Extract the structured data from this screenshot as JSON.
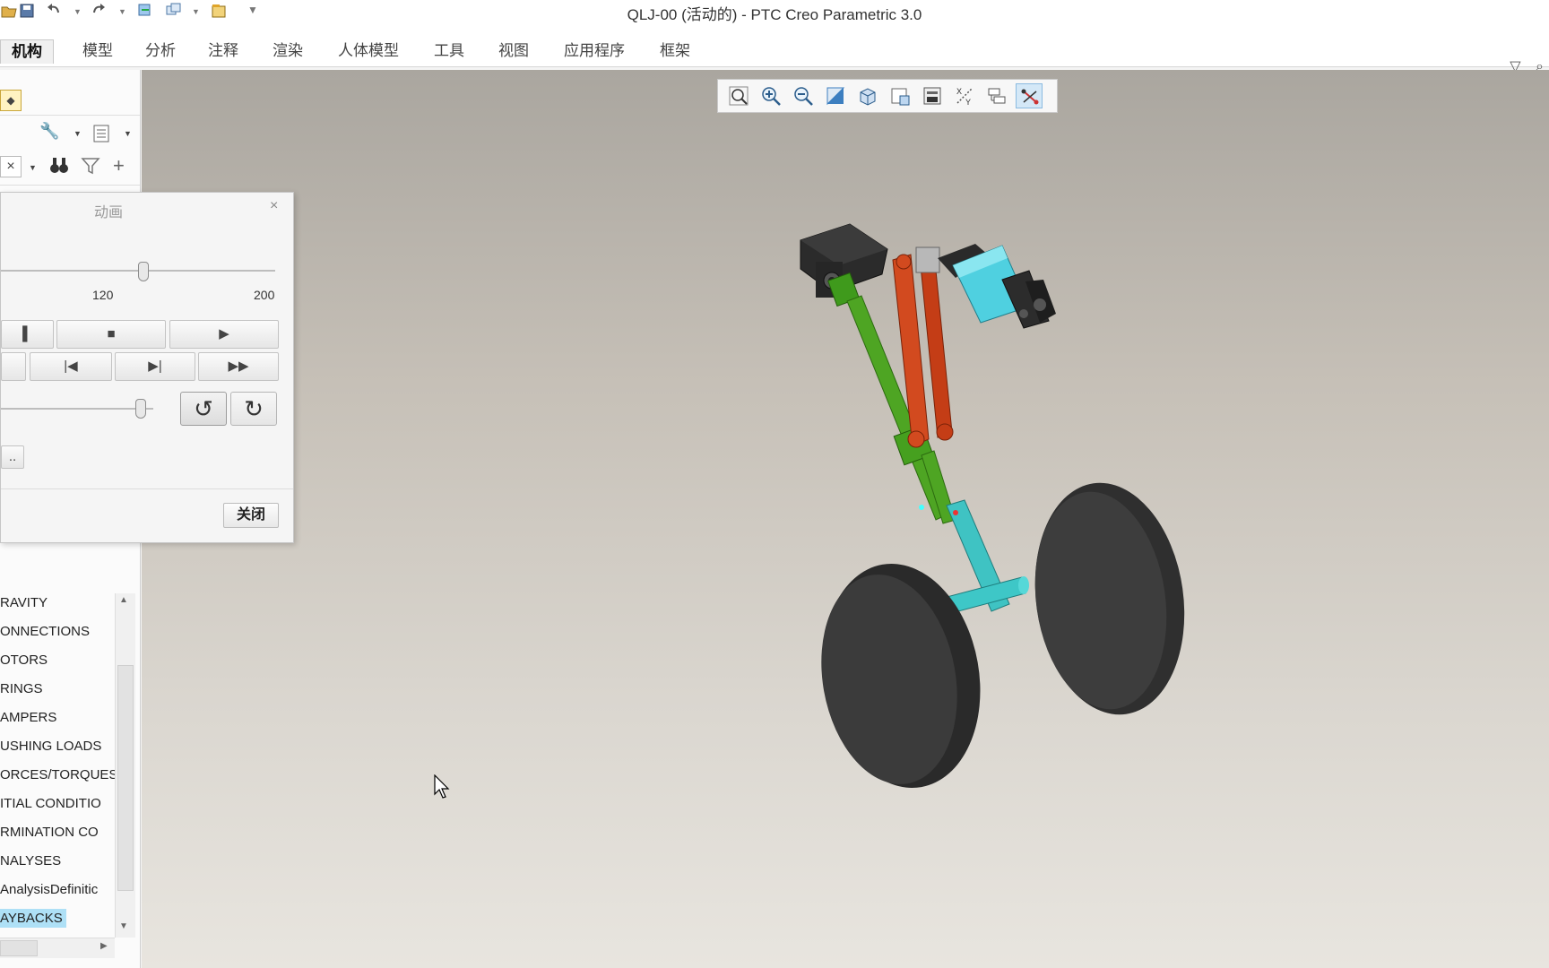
{
  "window": {
    "title": "QLJ-00 (活动的) - PTC Creo Parametric 3.0"
  },
  "quick_access": {
    "icons": [
      "open-icon",
      "save-icon",
      "undo-icon",
      "redo-icon",
      "regenerate-icon",
      "windows-icon",
      "close-window-icon",
      "customize-icon"
    ]
  },
  "ribbon": {
    "tabs": [
      {
        "label": "机构",
        "active": true
      },
      {
        "label": "模型"
      },
      {
        "label": "分析"
      },
      {
        "label": "注释"
      },
      {
        "label": "渲染"
      },
      {
        "label": "人体模型"
      },
      {
        "label": "工具"
      },
      {
        "label": "视图"
      },
      {
        "label": "应用程序"
      },
      {
        "label": "框架"
      }
    ]
  },
  "view_toolbar": {
    "icons": [
      "refit-icon",
      "zoom-in-icon",
      "zoom-out-icon",
      "repaint-icon",
      "display-style-icon",
      "saved-views-icon",
      "view-manager-icon",
      "datum-display-icon",
      "spin-center-icon",
      "mechanism-display-icon"
    ]
  },
  "animation_dialog": {
    "title": "动画",
    "frame_slider": {
      "value": 120,
      "min_label": "120",
      "max_label": "200"
    },
    "speed_slider": {
      "value_fraction": 1.0
    },
    "buttons": {
      "stop": "■",
      "play": "▶",
      "first": "|◀",
      "last": "▶|",
      "fast_forward": "▶▶",
      "loop": "↺",
      "reverse": "↻",
      "more": ".."
    },
    "close_label": "关闭"
  },
  "tree": {
    "items": [
      {
        "label": "RAVITY"
      },
      {
        "label": "ONNECTIONS"
      },
      {
        "label": "OTORS"
      },
      {
        "label": "RINGS"
      },
      {
        "label": "AMPERS"
      },
      {
        "label": "USHING LOADS"
      },
      {
        "label": "ORCES/TORQUES"
      },
      {
        "label": "ITIAL CONDITIO"
      },
      {
        "label": "RMINATION CO"
      },
      {
        "label": "NALYSES"
      },
      {
        "label": " AnalysisDefinitic"
      },
      {
        "label": "AYBACKS",
        "selected": true
      }
    ]
  },
  "colors": {
    "accent_selection": "#aee0f6",
    "model_green": "#4a9a1a",
    "model_red": "#d4401c",
    "model_cyan": "#3fc6c6",
    "wheel": "#3a3a3a"
  }
}
